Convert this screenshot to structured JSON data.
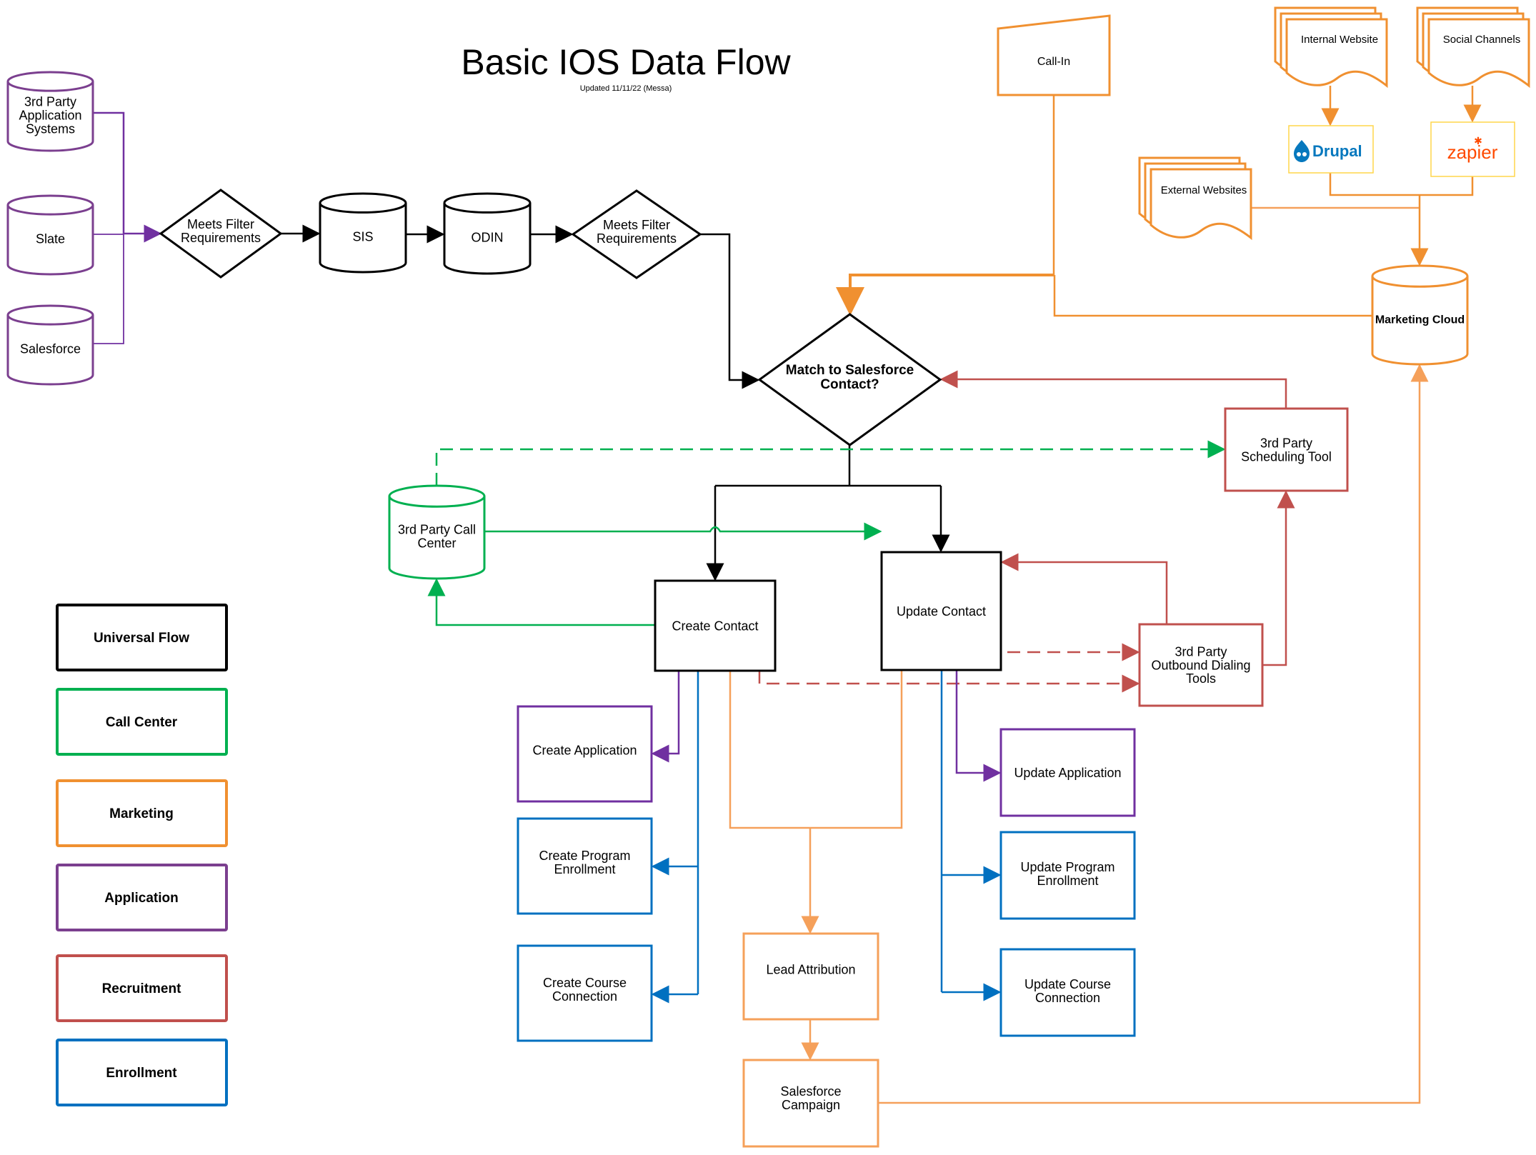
{
  "title": "Basic IOS Data Flow",
  "subtitle": "Updated 11/11/22 (Messa)",
  "colors": {
    "universal": "#000000",
    "call_center": "#00b050",
    "marketing": "#f09030",
    "marketing_light": "#f5a05a",
    "application": "#7030a0",
    "recruitment": "#c0504d",
    "enrollment": "#0070c0",
    "logo_border": "#ffd54a",
    "drupal_blue": "#0678be",
    "zapier_orange": "#ff4a00"
  },
  "nodes": {
    "third_party_app": [
      "3rd Party",
      "Application",
      "Systems"
    ],
    "slate": [
      "Slate"
    ],
    "salesforce": [
      "Salesforce"
    ],
    "filter1": [
      "Meets Filter",
      "Requirements"
    ],
    "sis": [
      "SIS"
    ],
    "odin": [
      "ODIN"
    ],
    "filter2": [
      "Meets Filter",
      "Requirements"
    ],
    "match": [
      "Match to Salesforce",
      "Contact?"
    ],
    "call_in": [
      "Call-In"
    ],
    "internal_website": [
      "Internal Website"
    ],
    "social_channels": [
      "Social Channels"
    ],
    "drupal": "Drupal",
    "zapier": "zapier",
    "external_websites": [
      "External Websites"
    ],
    "marketing_cloud": [
      "Marketing Cloud"
    ],
    "call_center": [
      "3rd Party Call",
      "Center"
    ],
    "scheduling_tool": [
      "3rd Party",
      "Scheduling Tool"
    ],
    "create_contact": [
      "Create Contact"
    ],
    "update_contact": [
      "Update Contact"
    ],
    "outbound_dialing": [
      "3rd Party",
      "Outbound Dialing",
      "Tools"
    ],
    "create_application": [
      "Create Application"
    ],
    "create_program_enrollment": [
      "Create Program",
      "Enrollment"
    ],
    "create_course_connection": [
      "Create Course",
      "Connection"
    ],
    "lead_attribution": [
      "Lead Attribution"
    ],
    "salesforce_campaign": [
      "Salesforce",
      "Campaign"
    ],
    "update_application": [
      "Update Application"
    ],
    "update_program_enrollment": [
      "Update Program",
      "Enrollment"
    ],
    "update_course_connection": [
      "Update Course",
      "Connection"
    ]
  },
  "legend": [
    {
      "label": "Universal Flow",
      "color": "#000000"
    },
    {
      "label": "Call Center",
      "color": "#00b050"
    },
    {
      "label": "Marketing",
      "color": "#f09030"
    },
    {
      "label": "Application",
      "color": "#7b3f8f"
    },
    {
      "label": "Recruitment",
      "color": "#c0504d"
    },
    {
      "label": "Enrollment",
      "color": "#0070c0"
    }
  ]
}
